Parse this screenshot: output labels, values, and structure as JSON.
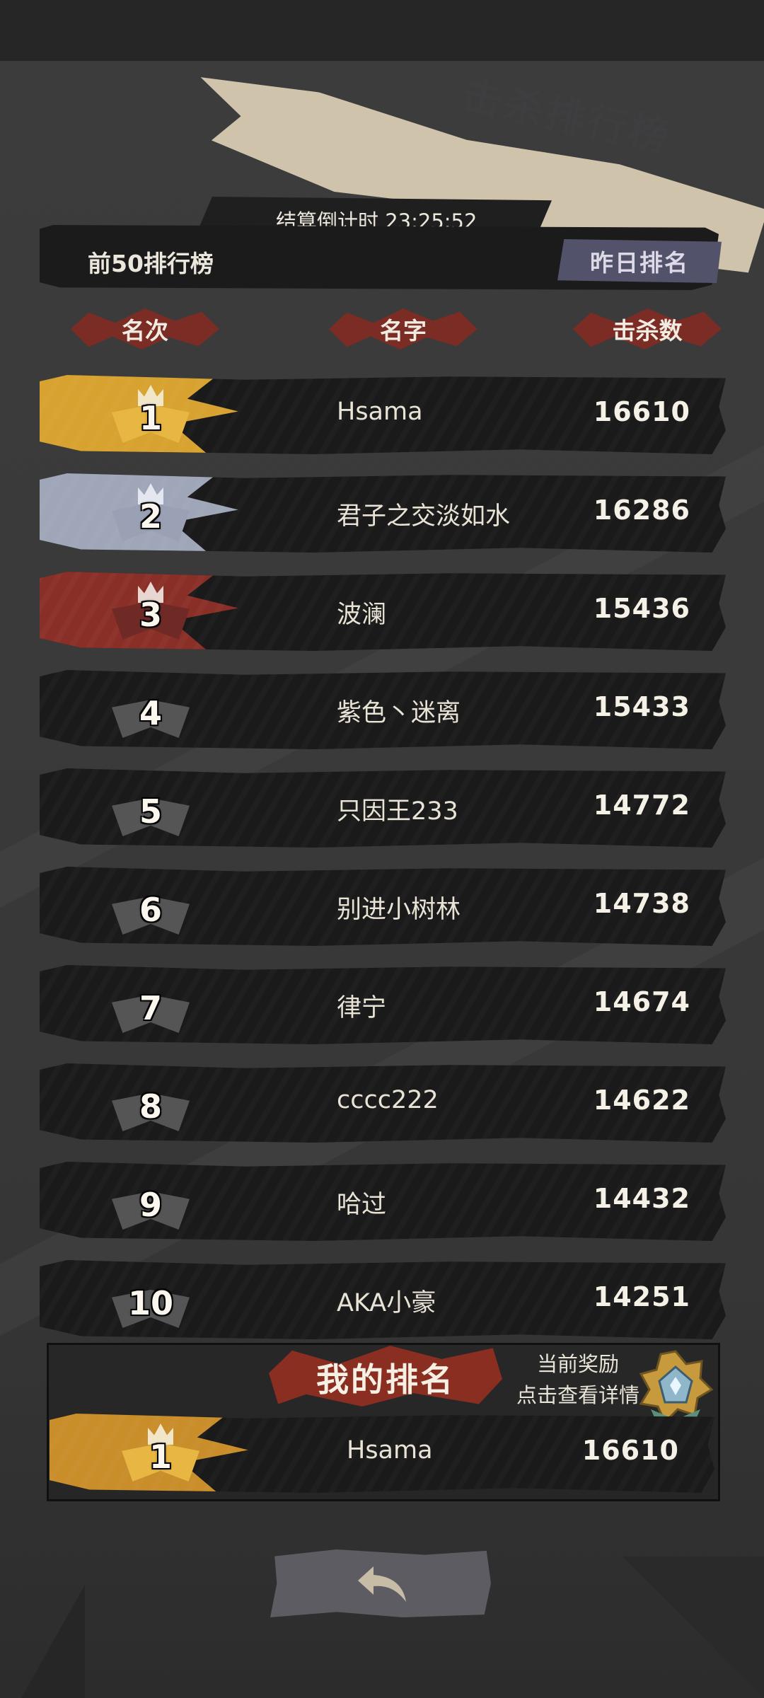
{
  "header": {
    "title": "击杀排行榜",
    "countdown": "结算倒计时 23:25:52",
    "board_label": "前50排行榜",
    "yesterday_button": "昨日排名"
  },
  "columns": {
    "rank": "名次",
    "name": "名字",
    "kills": "击杀数"
  },
  "rows": [
    {
      "rank": "1",
      "name": "Hsama",
      "kills": "16610"
    },
    {
      "rank": "2",
      "name": "君子之交淡如水",
      "kills": "16286"
    },
    {
      "rank": "3",
      "name": "波澜",
      "kills": "15436"
    },
    {
      "rank": "4",
      "name": "紫色丶迷离",
      "kills": "15433"
    },
    {
      "rank": "5",
      "name": "只因王233",
      "kills": "14772"
    },
    {
      "rank": "6",
      "name": "别进小树林",
      "kills": "14738"
    },
    {
      "rank": "7",
      "name": "律宁",
      "kills": "14674"
    },
    {
      "rank": "8",
      "name": "cccc222",
      "kills": "14622"
    },
    {
      "rank": "9",
      "name": "哈过",
      "kills": "14432"
    },
    {
      "rank": "10",
      "name": "AKA小豪",
      "kills": "14251"
    }
  ],
  "my_rank": {
    "title": "我的排名",
    "reward_line1": "当前奖励",
    "reward_line2": "点击查看详情",
    "rank": "1",
    "name": "Hsama",
    "kills": "16610"
  },
  "icons": {
    "back": "back-arrow-icon",
    "reward": "reward-medal-icon",
    "rank_badge": "rank-badge-icon"
  },
  "colors": {
    "gold": "#d7a22f",
    "silver": "#9ea6b8",
    "bronze": "#8a2f27",
    "accent_red": "#7b2c24",
    "button_purple": "#53526b"
  }
}
